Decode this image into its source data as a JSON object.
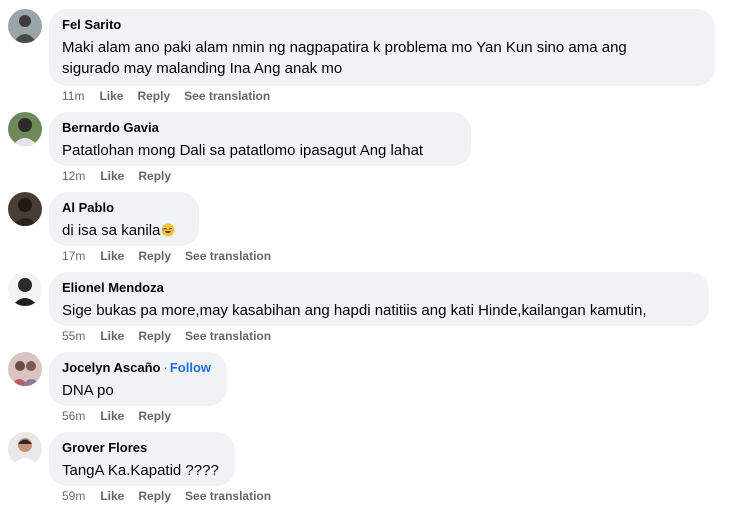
{
  "action_labels": {
    "like": "Like",
    "reply": "Reply",
    "see_translation": "See translation"
  },
  "comments": [
    {
      "author": "Fel Sarito",
      "text": "Maki alam ano paki alam nmin ng nagpapatira k problema mo Yan Kun sino ama ang sigurado may malanding Ina Ang anak mo",
      "time": "11m",
      "avatar_color": "#7b8a8e"
    },
    {
      "author": "Bernardo Gavia",
      "text": "Patatlohan mong Dali sa patatlomo ipasagut Ang lahat",
      "time": "12m",
      "avatar_color": "#5a6a4d"
    },
    {
      "author": "Al Pablo",
      "text": "di isa sa kanila",
      "emoji": "laughing-face",
      "time": "17m",
      "avatar_color": "#3a2e2a"
    },
    {
      "author": "Elionel Mendoza",
      "text": "Sige bukas pa more,may kasabihan ang hapdi natitiis ang kati Hinde,kailangan kamutin,",
      "time": "55m",
      "avatar_color": "#2b2b2b"
    },
    {
      "author": "Jocelyn Ascaño",
      "follow": "Follow",
      "separator": "·",
      "text": "DNA po",
      "time": "56m",
      "avatar_color": "#b99aa0"
    },
    {
      "author": "Grover Flores",
      "text": "TangA Ka.Kapatid ????",
      "time": "59m",
      "avatar_color": "#c8c8c8"
    }
  ]
}
